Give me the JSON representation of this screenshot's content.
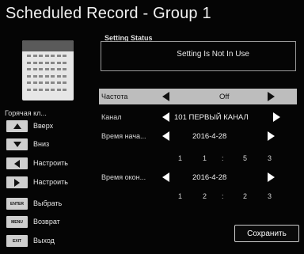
{
  "title": "Scheduled Record - Group 1",
  "status": {
    "label": "Setting Status",
    "value": "Setting Is Not In Use"
  },
  "calendar_icon": "calendar-icon",
  "hotkeys": {
    "title": "Горячая кл...",
    "items": [
      {
        "key": "up",
        "label": "Вверх"
      },
      {
        "key": "down",
        "label": "Вниз"
      },
      {
        "key": "left",
        "label": "Настроить"
      },
      {
        "key": "right",
        "label": "Настроить"
      },
      {
        "key": "ENTER",
        "label": "Выбрать"
      },
      {
        "key": "MENU",
        "label": "Возврат"
      },
      {
        "key": "EXIT",
        "label": "Выход"
      }
    ]
  },
  "form": {
    "frequency": {
      "label": "Частота",
      "value": "Off"
    },
    "channel": {
      "label": "Канал",
      "value": "101 ПЕРВЫЙ КАНАЛ"
    },
    "start_time": {
      "label": "Время нача...",
      "date": "2016-4-28",
      "time": [
        "1",
        "1",
        ":",
        "5",
        "3"
      ]
    },
    "end_time": {
      "label": "Время окон...",
      "date": "2016-4-28",
      "time": [
        "1",
        "2",
        ":",
        "2",
        "3"
      ]
    }
  },
  "save_button": "Сохранить"
}
